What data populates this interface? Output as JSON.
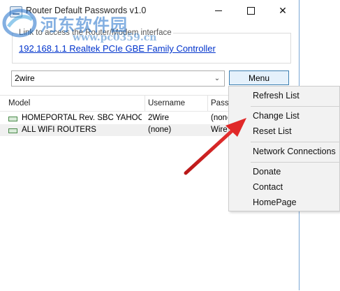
{
  "window": {
    "title": "Router Default Passwords v1.0",
    "controls": {
      "minimize": "",
      "maximize": "",
      "close": "✕"
    }
  },
  "router_group": {
    "label": "Link to access the Router/Modem interface",
    "link": "192.168.1.1   Realtek PCIe GBE Family Controller"
  },
  "toolbar": {
    "combo_value": "2wire",
    "combo_arrow": "⌄",
    "menu_label": "Menu"
  },
  "table": {
    "columns": [
      "Model",
      "Username",
      "Passw"
    ],
    "rows": [
      {
        "model": "HOMEPORTAL Rev. SBC YAHOO!...",
        "username": "2Wire",
        "password": "(none"
      },
      {
        "model": "ALL WIFI ROUTERS",
        "username": "(none)",
        "password": "Wirel"
      }
    ]
  },
  "popup_menu": {
    "items": [
      "Refresh List",
      "Change List",
      "Reset List",
      "Network Connections",
      "Donate",
      "Contact",
      "HomePage"
    ]
  },
  "watermark": {
    "text": "河东软件园",
    "url": "www.pc0359.cn"
  },
  "colors": {
    "link": "#0033cc",
    "menu_button_bg": "#e5f1fb",
    "menu_button_border": "#3c7fb1",
    "arrow": "#d42020"
  }
}
